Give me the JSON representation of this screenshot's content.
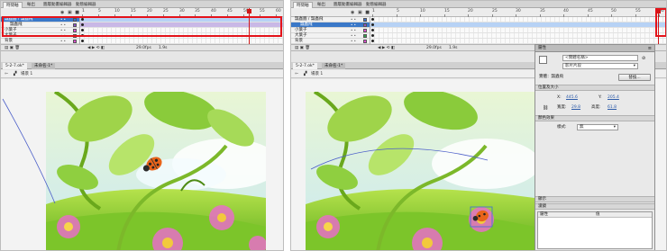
{
  "left": {
    "panel_tabs": [
      "時間軸",
      "輸出",
      "圖層動畫編輯器",
      "動態編輯器"
    ],
    "ruler_ticks": [
      "1",
      "5",
      "10",
      "15",
      "20",
      "25",
      "30",
      "35",
      "40",
      "45",
      "50",
      "55",
      "60"
    ],
    "layers": [
      {
        "name": "瓢蟲圖 / 瓢蟲飛",
        "selected": true,
        "color": "#3b6fd1"
      },
      {
        "name": "瓢蟲飛",
        "selected": false,
        "color": "#8a55c9"
      },
      {
        "name": "小葉子",
        "selected": false,
        "color": "#e04bd2"
      },
      {
        "name": "大葉子",
        "selected": false,
        "color": "#30a84a"
      },
      {
        "name": "背景",
        "selected": false,
        "color": "#e04bd2"
      }
    ],
    "footer": {
      "fps": "29.0fps",
      "time": "1.9s"
    },
    "doc_tabs": [
      "5-2-7.ok*",
      "未命名-1*"
    ],
    "breadcrumb": "場景 1"
  },
  "right": {
    "panel_tabs": [
      "時間軸",
      "輸出",
      "圖層動畫編輯器",
      "動態編輯器"
    ],
    "ruler_ticks": [
      "1",
      "5",
      "10",
      "15",
      "20",
      "25",
      "30",
      "35",
      "40",
      "45",
      "50",
      "55",
      "60"
    ],
    "layers": [
      {
        "name": "瓢蟲圖 / 瓢蟲飛",
        "selected": false,
        "color": "#3b6fd1"
      },
      {
        "name": "瓢蟲飛",
        "selected": true,
        "color": "#8a55c9"
      },
      {
        "name": "小葉子",
        "selected": false,
        "color": "#e04bd2"
      },
      {
        "name": "大葉子",
        "selected": false,
        "color": "#30a84a"
      },
      {
        "name": "背景",
        "selected": false,
        "color": "#e04bd2"
      }
    ],
    "footer": {
      "fps": "29.0fps",
      "time": "1.9s"
    },
    "doc_tabs": [
      "5-2-7.ok*",
      "未命名-1*"
    ],
    "breadcrumb": "場景 1",
    "properties": {
      "title": "屬性",
      "instance_name_placeholder": "<實體名稱>",
      "symbol_type": "影片片段",
      "instance_of_label": "實體：瓢蟲飛",
      "swap_button": "替換...",
      "section_position": "位置及大小",
      "x_label": "X:",
      "x_value": "445.6",
      "y_label": "Y:",
      "y_value": "205.4",
      "w_label": "寬度:",
      "w_value": "29.8",
      "h_label": "高度:",
      "h_value": "61.8",
      "section_color": "顏色效果",
      "style_label": "樣式:",
      "style_value": "無",
      "section_display": "顯示",
      "section_filters": "濾鏡",
      "col_property": "屬性",
      "col_value": "值"
    }
  }
}
